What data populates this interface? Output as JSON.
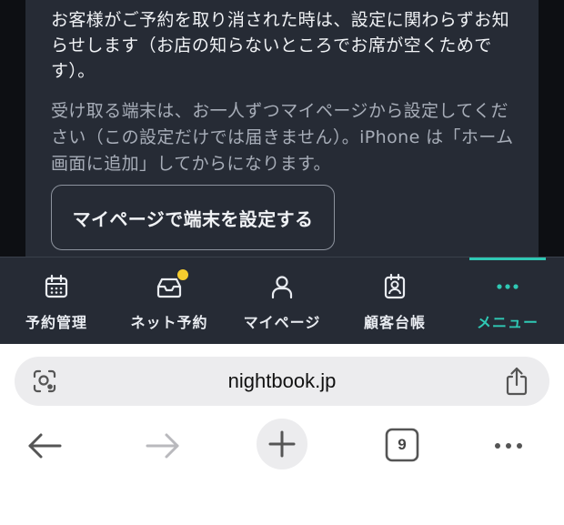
{
  "content": {
    "notice_paragraph": "お客様がご予約を取り消された時は、設定に関わらずお知らせします（お店の知らないところでお席が空くためです）。",
    "device_paragraph": "受け取る端末は、お一人ずつマイページから設定してください（この設定だけでは届きません）。iPhone は「ホーム画面に追加」してからになります。",
    "setup_button_label": "マイページで端末を設定する"
  },
  "tabbar": {
    "items": [
      {
        "label": "予約管理",
        "icon": "calendar-icon",
        "active": false
      },
      {
        "label": "ネット予約",
        "icon": "inbox-icon",
        "active": false,
        "badge": true
      },
      {
        "label": "マイページ",
        "icon": "user-icon",
        "active": false
      },
      {
        "label": "顧客台帳",
        "icon": "contact-card-icon",
        "active": false
      },
      {
        "label": "メニュー",
        "icon": "more-dots-icon",
        "active": true
      }
    ],
    "accent_color": "#2fc8b4",
    "badge_color": "#f5cc2e"
  },
  "browser": {
    "url": "nightbook.jp",
    "tab_count": "9"
  }
}
